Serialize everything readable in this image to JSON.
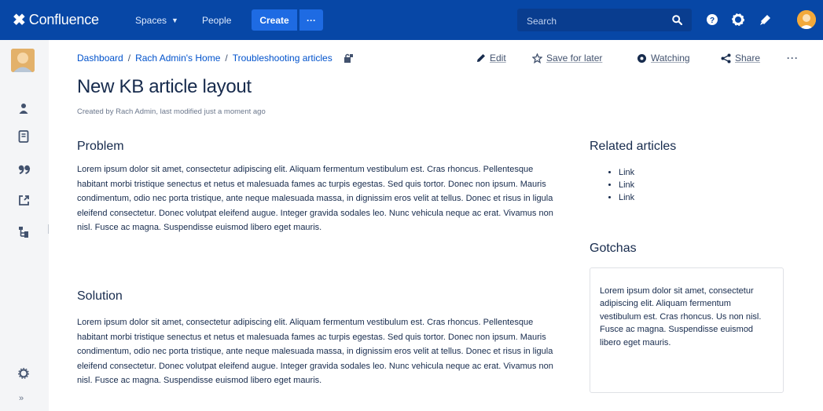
{
  "header": {
    "app_name": "Confluence",
    "nav": [
      {
        "label": "Spaces"
      },
      {
        "label": "People"
      }
    ],
    "create_label": "Create",
    "more_label": "···",
    "search_placeholder": "Search",
    "colors": {
      "bar": "#0747a6",
      "create": "#1e6be3"
    }
  },
  "sidebar": {
    "icons": [
      "space-avatar",
      "people-icon",
      "pages-icon",
      "blog-quote-icon",
      "export-icon",
      "page-tree-icon",
      "settings-icon",
      "expand-sidebar-icon"
    ],
    "collapse_label": "»"
  },
  "breadcrumb": {
    "items": [
      "Dashboard",
      "Rach Admin's Home",
      "Troubleshooting articles"
    ],
    "separator": "/"
  },
  "actions": {
    "edit": "Edit",
    "save": "Save for later",
    "watch": "Watching",
    "share": "Share",
    "more": "···"
  },
  "page": {
    "title": "New KB article layout",
    "byline": "Created by Rach Admin, last modified just a moment ago"
  },
  "sections": {
    "problem": {
      "heading": "Problem",
      "text": "Lorem ipsum dolor sit amet, consectetur adipiscing elit. Aliquam fermentum vestibulum est. Cras rhoncus. Pellentesque habitant morbi tristique senectus et netus et malesuada fames ac turpis egestas. Sed quis tortor. Donec non ipsum. Mauris condimentum, odio nec porta tristique, ante neque malesuada massa, in dignissim eros velit at tellus. Donec et risus in ligula eleifend consectetur. Donec volutpat eleifend augue. Integer gravida sodales leo. Nunc vehicula neque ac erat. Vivamus non nisl. Fusce ac magna. Suspendisse euismod libero eget mauris."
    },
    "solution": {
      "heading": "Solution",
      "text": "Lorem ipsum dolor sit amet, consectetur adipiscing elit. Aliquam fermentum vestibulum est. Cras rhoncus. Pellentesque habitant morbi tristique senectus et netus et malesuada fames ac turpis egestas. Sed quis tortor. Donec non ipsum. Mauris condimentum, odio nec porta tristique, ante neque malesuada massa, in dignissim eros velit at tellus. Donec et risus in ligula eleifend consectetur. Donec volutpat eleifend augue. Integer gravida sodales leo. Nunc vehicula neque ac erat. Vivamus non nisl. Fusce ac magna. Suspendisse euismod libero eget mauris."
    }
  },
  "related": {
    "heading": "Related articles",
    "links": [
      "Link",
      "Link",
      "Link"
    ]
  },
  "gotchas": {
    "heading": "Gotchas",
    "text": "Lorem ipsum dolor sit amet, consectetur adipiscing elit. Aliquam fermentum vestibulum est. Cras rhoncus. Us non nisl. Fusce ac magna. Suspendisse euismod libero eget mauris."
  }
}
